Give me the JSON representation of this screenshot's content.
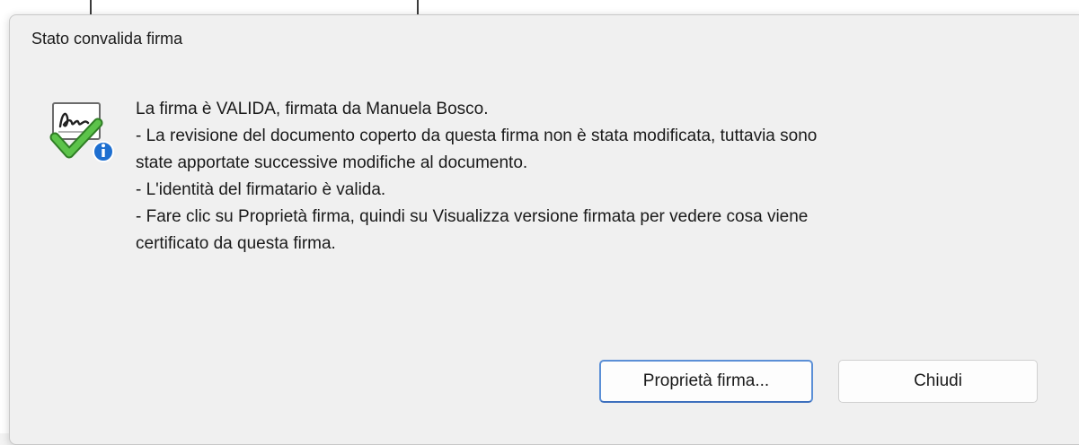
{
  "dialog": {
    "title": "Stato convalida firma",
    "message_lines": [
      "La firma è VALIDA, firmata da Manuela Bosco.",
      "- La revisione del documento coperto da questa firma non è stata modificata, tuttavia sono",
      "state apportate successive modifiche al documento.",
      "- L'identità del firmatario è valida.",
      "- Fare clic su Proprietà firma, quindi su Visualizza versione firmata per vedere cosa viene",
      "certificato da questa firma."
    ],
    "icon": "signature-valid-icon",
    "buttons": {
      "properties_label": "Proprietà firma...",
      "close_label": "Chiudi"
    }
  },
  "colors": {
    "dialog_background": "#f0f0f0",
    "primary_border": "#5b8fd6",
    "check_green": "#4caf3a",
    "info_blue": "#1e6fd0"
  }
}
